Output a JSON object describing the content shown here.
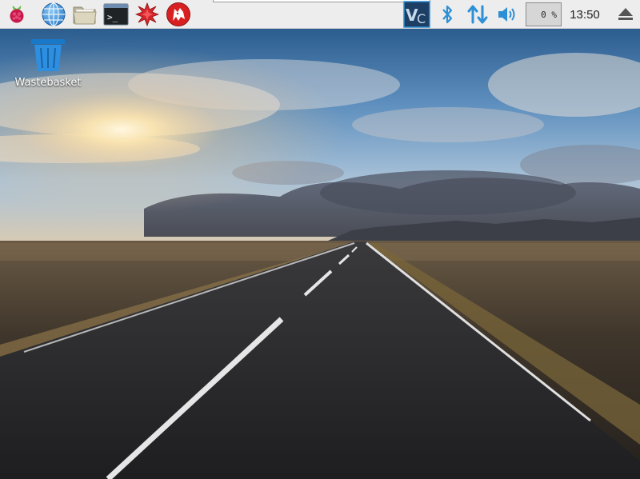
{
  "taskbar": {
    "launchers": [
      {
        "name": "Menu",
        "icon": "raspberry-pi-icon"
      },
      {
        "name": "Web Browser",
        "icon": "globe-icon"
      },
      {
        "name": "File Manager",
        "icon": "folder-icon"
      },
      {
        "name": "Terminal",
        "icon": "terminal-icon"
      },
      {
        "name": "Mathematica",
        "icon": "mathematica-icon"
      },
      {
        "name": "Wolfram",
        "icon": "wolfram-icon"
      }
    ],
    "tray": {
      "vnc_icon": "vnc-icon",
      "bluetooth_icon": "bluetooth-icon",
      "network_icon": "network-arrows-icon",
      "volume_icon": "volume-icon",
      "cpu_usage": "0 %",
      "clock": "13:50",
      "eject_icon": "eject-icon"
    },
    "colors": {
      "bar": "#ededed",
      "accent_blue": "#2d8fd5",
      "raspberry": "#c51a4a"
    }
  },
  "desktop": {
    "icons": [
      {
        "label": "Wastebasket",
        "icon": "wastebasket-icon"
      }
    ]
  }
}
